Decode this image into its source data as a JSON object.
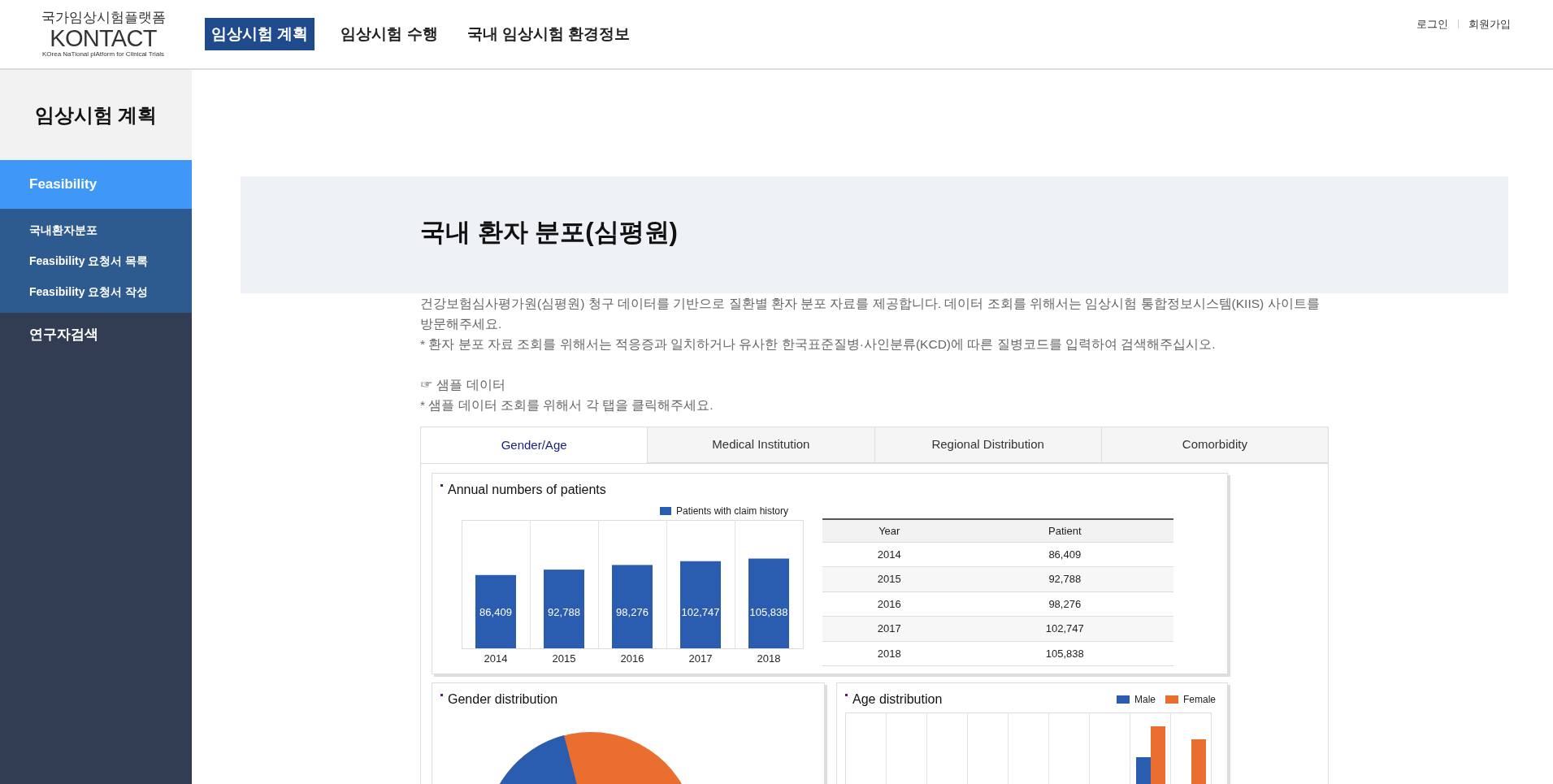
{
  "header": {
    "logo": {
      "title": "국가임상시험플랫폼",
      "name": "KONTACT",
      "tagline": "KOrea NaTional plAtform for Clinical Trials"
    },
    "nav": [
      {
        "label": "임상시험 계획",
        "selected": true
      },
      {
        "label": "임상시험 수행",
        "selected": false
      },
      {
        "label": "국내 임상시험 환경정보",
        "selected": false
      }
    ],
    "auth_links": [
      "로그인",
      "회원가입"
    ]
  },
  "sidebar": {
    "title": "임상시험 계획",
    "items": [
      {
        "label": "Feasibility",
        "selected": true,
        "children": [
          {
            "label": "국내환자분포"
          },
          {
            "label": "Feasibility 요청서 목록"
          },
          {
            "label": "Feasibility 요청서 작성"
          }
        ]
      },
      {
        "label": "연구자검색",
        "selected": false
      }
    ]
  },
  "page": {
    "title": "국내 환자 분포(심평원)",
    "intro": [
      "건강보험심사평가원(심평원) 청구 데이터를 기반으로 질환별 환자 분포 자료를 제공합니다. 데이터 조회를 위해서는 임상시험 통합정보시스템(KIIS) 사이트를 방문해주세요.",
      "* 환자 분포 자료 조회를 위해서는 적응증과 일치하거나 유사한 한국표준질병·사인분류(KCD)에 따른 질병코드를 입력하여 검색해주십시오."
    ],
    "sample_heading": "☞ 샘플 데이터",
    "sample_note": "* 샘플 데이터 조회를 위해서 각 탭을 클릭해주세요."
  },
  "tabs": [
    {
      "label": "Gender/Age",
      "selected": true
    },
    {
      "label": "Medical Institution",
      "selected": false
    },
    {
      "label": "Regional Distribution",
      "selected": false
    },
    {
      "label": "Comorbidity",
      "selected": false
    }
  ],
  "annual": {
    "title": "Annual numbers of patients",
    "chart_data": {
      "type": "bar",
      "categories": [
        "2014",
        "2015",
        "2016",
        "2017",
        "2018"
      ],
      "data_labels": true,
      "series": [
        {
          "name": "Patients with claim history",
          "color": "#2a5db0",
          "values": [
            86409,
            92788,
            98276,
            102747,
            105838
          ],
          "value_labels": [
            "86,409",
            "92,788",
            "98,276",
            "102,747",
            "105,838"
          ]
        }
      ]
    },
    "table": {
      "columns": [
        "Year",
        "Patient"
      ],
      "rows": [
        [
          "2014",
          "86,409"
        ],
        [
          "2015",
          "92,788"
        ],
        [
          "2016",
          "98,276"
        ],
        [
          "2017",
          "102,747"
        ],
        [
          "2018",
          "105,838"
        ]
      ]
    }
  },
  "gender": {
    "title": "Gender distribution"
  },
  "age": {
    "title": "Age distribution",
    "legend": [
      {
        "label": "Male",
        "color": "#2a5db0"
      },
      {
        "label": "Female",
        "color": "#eb6e31"
      }
    ]
  }
}
